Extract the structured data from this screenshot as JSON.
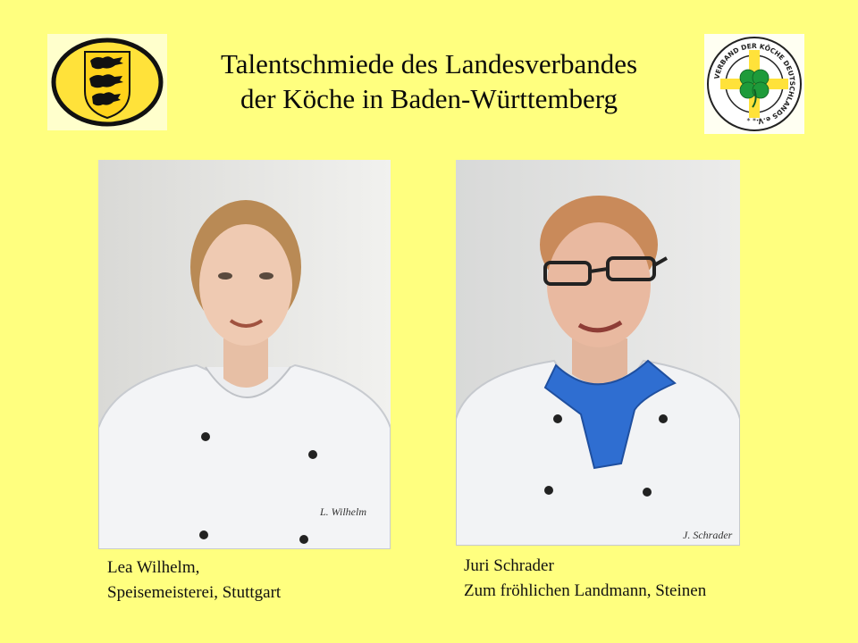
{
  "slide": {
    "background": "#ffff7f",
    "title_line1": "Talentschmiede des Landesverbandes",
    "title_line2": "der Köche in Baden-Württemberg"
  },
  "logos": {
    "left": {
      "icon": "baden-wuerttemberg-coat-of-arms-icon",
      "colors": {
        "oval": "#ffe23a",
        "lions": "#111111"
      }
    },
    "right": {
      "icon": "verband-der-koeche-clover-seal-icon",
      "text": "VERBAND DER KÖCHE DEUTSCHLANDS e.V.",
      "colors": {
        "clover": "#1e9b3a",
        "ring": "#222222"
      }
    }
  },
  "people": [
    {
      "name_line": "Lea Wilhelm,",
      "place_line": "Speisemeisterei, Stuttgart",
      "name_tag": "L. Wilhelm"
    },
    {
      "name_line": "Juri Schrader",
      "place_line": "Zum fröhlichen Landmann, Steinen",
      "name_tag": "J. Schrader"
    }
  ]
}
